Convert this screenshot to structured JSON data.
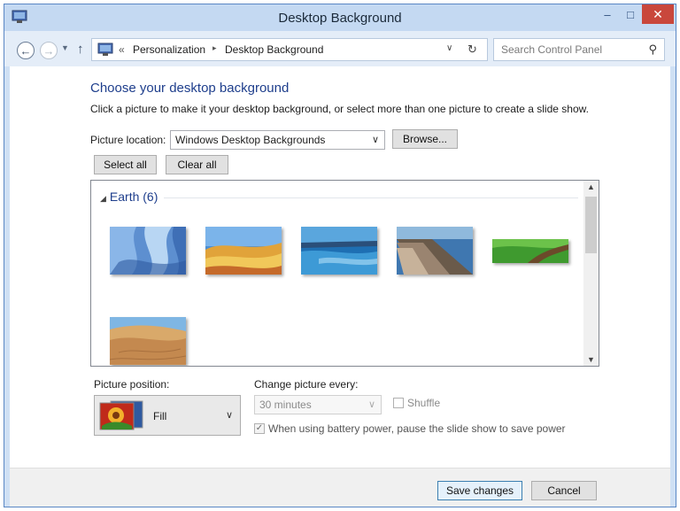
{
  "window": {
    "title": "Desktop Background",
    "controls": {
      "minimize": "–",
      "maximize": "□",
      "close": "✕"
    }
  },
  "nav": {
    "breadcrumb_chevron": "«",
    "breadcrumb": [
      "Personalization",
      "Desktop Background"
    ],
    "breadcrumb_sep": "▸",
    "search_placeholder": "Search Control Panel"
  },
  "content": {
    "title": "Choose your desktop background",
    "subtitle": "Click a picture to make it your desktop background, or select more than one picture to create a slide show.",
    "location_label": "Picture location:",
    "location_value": "Windows Desktop Backgrounds",
    "browse_label": "Browse...",
    "select_all_label": "Select all",
    "clear_all_label": "Clear all",
    "gallery": {
      "group_label": "Earth (6)",
      "thumbnails": [
        {
          "name": "ice-cave"
        },
        {
          "name": "painted-hills"
        },
        {
          "name": "blue-seascape"
        },
        {
          "name": "rock-shoreline"
        },
        {
          "name": "green-hills"
        },
        {
          "name": "sand-dunes"
        }
      ]
    },
    "position_label": "Picture position:",
    "position_value": "Fill",
    "change_label": "Change picture every:",
    "interval_value": "30 minutes",
    "shuffle_label": "Shuffle",
    "shuffle_checked": false,
    "battery_label": "When using battery power, pause the slide show to save power",
    "battery_checked": true
  },
  "footer": {
    "save_label": "Save changes",
    "cancel_label": "Cancel"
  },
  "colors": {
    "title_blue": "#1e3e8c",
    "close_red": "#c9473c",
    "frame_blue": "#cfe0f4"
  }
}
